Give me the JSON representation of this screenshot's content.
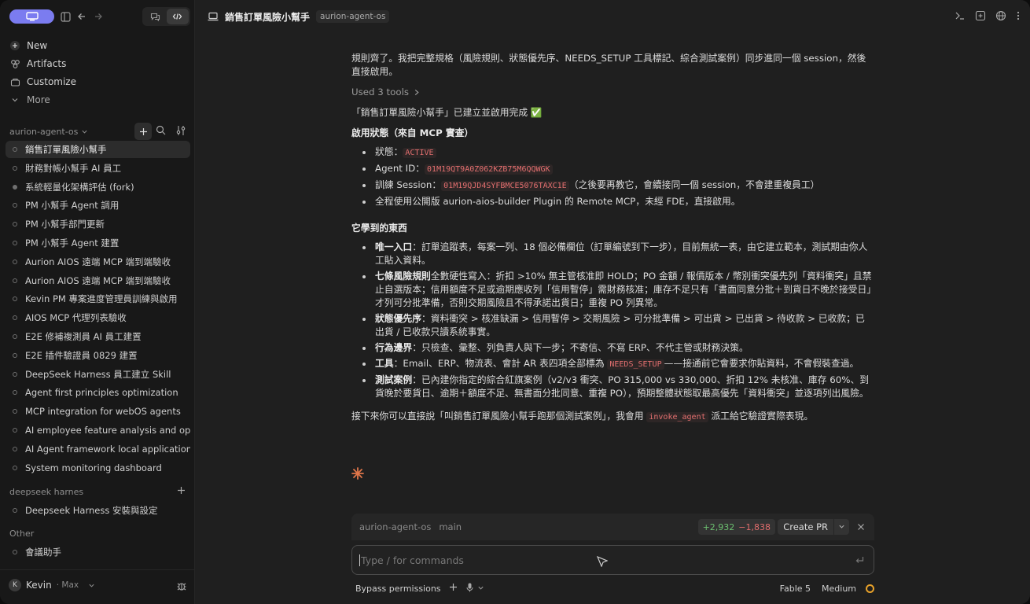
{
  "sidebar": {
    "nav": [
      {
        "icon": "plus-circle-icon",
        "label": "New"
      },
      {
        "icon": "artifacts-icon",
        "label": "Artifacts"
      },
      {
        "icon": "customize-icon",
        "label": "Customize"
      },
      {
        "icon": "chevron-down-icon",
        "label": "More"
      }
    ],
    "project_heading": "aurion-agent-os",
    "sessions": [
      "銷售訂單風險小幫手",
      "財務對帳小幫手 AI 員工",
      "系統輕量化架構評估 (fork)",
      "PM 小幫手 Agent 調用",
      "PM 小幫手部門更新",
      "PM 小幫手 Agent 建置",
      "Aurion AIOS 遠端 MCP 端到端驗收",
      "Aurion AIOS 遠端 MCP 端到端驗收",
      "Kevin PM 專案進度管理員訓練與啟用",
      "AIOS MCP 代理列表驗收",
      "E2E 修補複測員 AI 員工建置",
      "E2E 插件驗證員 0829 建置",
      "DeepSeek Harness 員工建立 Skill",
      "Agent first principles optimization",
      "MCP integration for webOS agents",
      "AI employee feature analysis and optim",
      "AI Agent framework local application",
      "System monitoring dashboard"
    ],
    "group2_heading": "deepseek harnes",
    "group2_sessions": [
      "Deepseek Harness 安裝與設定"
    ],
    "group3_heading": "Other",
    "group3_sessions": [
      "會議助手"
    ],
    "user_name": "Kevin",
    "user_plan": "· Max",
    "user_initial": "K"
  },
  "header": {
    "title": "銷售訂單風險小幫手",
    "badge": "aurion-agent-os"
  },
  "message": {
    "intro": "規則齊了。我把完整規格（風險規則、狀態優先序、NEEDS_SETUP 工具標記、綜合測試案例）同步進同一個 session，然後直接啟用。",
    "tools": "Used 3 tools",
    "done": "「銷售訂單風險小幫手」已建立並啟用完成 ✅",
    "status_heading": "啟用狀態（來自 MCP 實查）",
    "status_items": [
      {
        "pre": "狀態：",
        "code": "ACTIVE",
        "post": ""
      },
      {
        "pre": "Agent ID：",
        "code": "01M19QT9A0Z062KZB75M6QQWGK",
        "post": ""
      },
      {
        "pre": "訓練 Session：",
        "code": "01M19QJD4SYFBMCE5076TAXC1E",
        "post": "（之後要再教它，會續接同一個 session，不會建重複員工）"
      },
      {
        "pre": "全程使用公開版 aurion-aios-builder Plugin 的 Remote MCP，未經 FDE，直接啟用。",
        "code": "",
        "post": ""
      }
    ],
    "learned_heading": "它學到的東西",
    "learned_items": [
      {
        "b": "唯一入口",
        "t": "：訂單追蹤表，每案一列、18 個必備欄位（訂單編號到下一步），目前無統一表，由它建立範本，測試期由你人工貼入資料。",
        "code": "",
        "t2": ""
      },
      {
        "b": "七條風險規則",
        "t": "全數硬性寫入：折扣 >10% 無主管核准即 HOLD；PO 金額 / 報價版本 / 幣別衝突優先列「資料衝突」且禁止自選版本；信用額度不足或逾期應收列「信用暫停」需財務核准；庫存不足只有「書面同意分批＋到貨日不晚於接受日」才列可分批準備，否則交期風險且不得承諾出貨日；重複 PO 列異常。",
        "code": "",
        "t2": ""
      },
      {
        "b": "狀態優先序",
        "t": "：資料衝突 > 核准缺漏 > 信用暫停 > 交期風險 > 可分批準備 > 可出貨 > 已出貨 > 待收款 > 已收款；已出貨 / 已收款只讀系統事實。",
        "code": "",
        "t2": ""
      },
      {
        "b": "行為邊界",
        "t": "：只檢查、彙整、列負責人與下一步；不寄信、不寫 ERP、不代主管或財務決策。",
        "code": "",
        "t2": ""
      },
      {
        "b": "工具",
        "t": "：Email、ERP、物流表、會計 AR 表四項全部標為 ",
        "code": "NEEDS_SETUP",
        "t2": "——接通前它會要求你貼資料，不會假裝查過。"
      },
      {
        "b": "測試案例",
        "t": "：已內建你指定的綜合紅旗案例（v2/v3 衝突、PO 315,000 vs 330,000、折扣 12% 未核准、庫存 60%、到貨晚於要貨日、逾期＋額度不足、無書面分批同意、重複 PO），預期整體狀態取最高優先「資料衝突」並逐項列出風險。",
        "code": "",
        "t2": ""
      }
    ],
    "next_pre": "接下來你可以直接說「叫銷售訂單風險小幫手跑那個測試案例」，我會用 ",
    "next_code": "invoke_agent",
    "next_post": " 派工給它驗證實際表現。"
  },
  "gitbar": {
    "repo": "aurion-agent-os",
    "branch": "main",
    "added": "+2,932",
    "removed": "−1,838",
    "pr_label": "Create PR"
  },
  "input": {
    "placeholder": "Type / for commands"
  },
  "bottom": {
    "permissions": "Bypass permissions",
    "model": "Fable 5",
    "effort": "Medium"
  },
  "colors": {
    "accent": "#7b7cf0",
    "added": "#6cc070",
    "removed": "#e06c6c",
    "spark": "#e0764a",
    "ring": "#e8a22a"
  }
}
